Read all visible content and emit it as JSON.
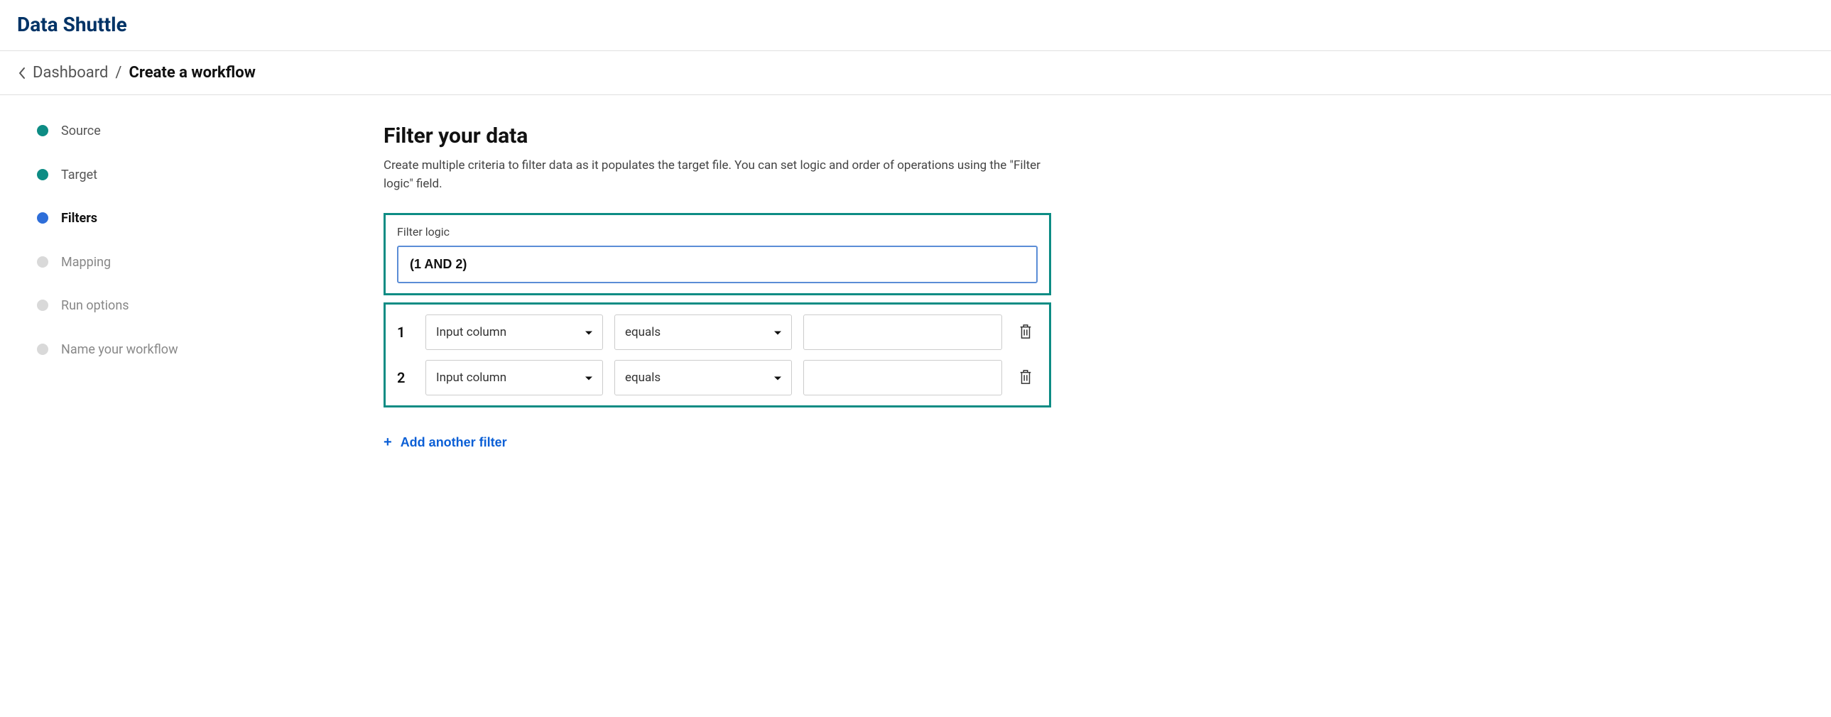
{
  "app_title": "Data Shuttle",
  "breadcrumb": {
    "parent": "Dashboard",
    "separator": "/",
    "current": "Create a workflow"
  },
  "sidebar": {
    "steps": [
      {
        "label": "Source",
        "state": "completed"
      },
      {
        "label": "Target",
        "state": "completed"
      },
      {
        "label": "Filters",
        "state": "active"
      },
      {
        "label": "Mapping",
        "state": "upcoming"
      },
      {
        "label": "Run options",
        "state": "upcoming"
      },
      {
        "label": "Name your workflow",
        "state": "upcoming"
      }
    ]
  },
  "page": {
    "title": "Filter your data",
    "description": "Create multiple criteria to filter data as it populates the target file. You can set logic and order of operations using the \"Filter logic\" field."
  },
  "filter_logic": {
    "label": "Filter logic",
    "value": "(1 AND 2)"
  },
  "filters": [
    {
      "index": "1",
      "column": "Input column",
      "operator": "equals",
      "value": ""
    },
    {
      "index": "2",
      "column": "Input column",
      "operator": "equals",
      "value": ""
    }
  ],
  "add_filter_label": "Add another filter"
}
